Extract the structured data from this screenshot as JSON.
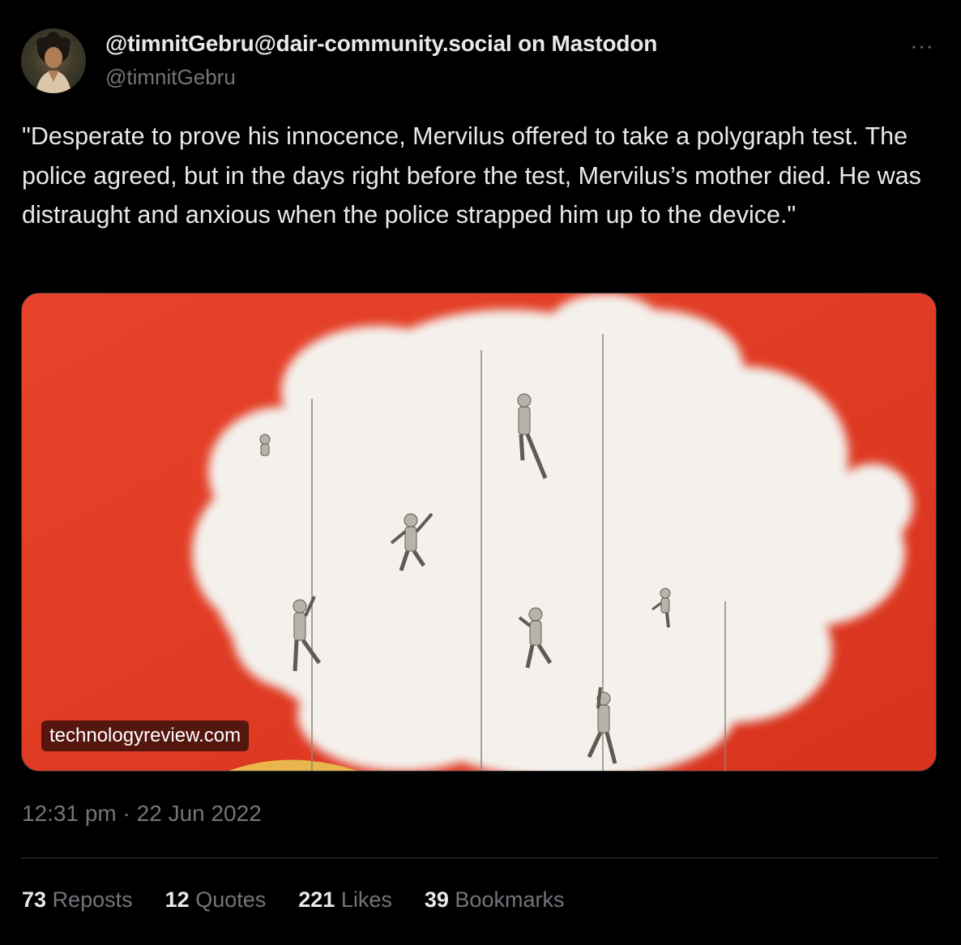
{
  "author": {
    "display_name": "@timnitGebru@dair-community.social on Mastodon",
    "handle": "@timnitGebru",
    "avatar_icon": "profile-photo"
  },
  "more_icon": "more-horizontal-icon",
  "more_label": "···",
  "tweet": {
    "text": "\"Desperate to prove his innocence, Mervilus offered to take a polygraph test. The police agreed, but in the days right before the test, Mervilus’s mother died. He was distraught and anxious when the police strapped him up to the device.\""
  },
  "media": {
    "domain": "technologyreview.com",
    "image_icon": "illustration-clouds-climbers",
    "colors": {
      "background": "#e03a22",
      "cloud": "#f4f1ec"
    }
  },
  "meta": {
    "time": "12:31 pm",
    "separator": "·",
    "date": "22 Jun 2022"
  },
  "stats": [
    {
      "count": "73",
      "label": "Reposts"
    },
    {
      "count": "12",
      "label": "Quotes"
    },
    {
      "count": "221",
      "label": "Likes"
    },
    {
      "count": "39",
      "label": "Bookmarks"
    }
  ],
  "colors": {
    "background": "#000000",
    "text": "#e7e9ea",
    "secondary": "#71767b",
    "divider": "#2f3336"
  }
}
